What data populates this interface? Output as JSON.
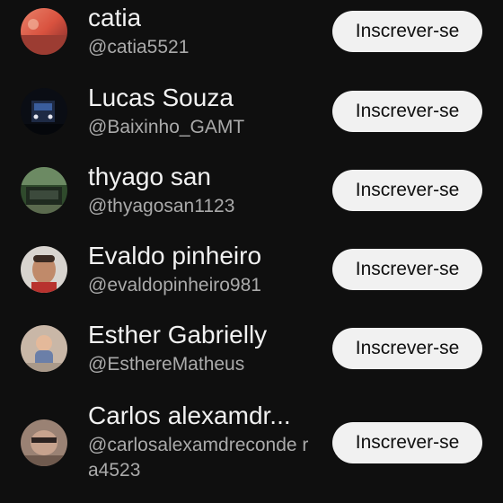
{
  "subscribe_label": "Inscrever-se",
  "channels": [
    {
      "name": "catia",
      "handle": "@catia5521"
    },
    {
      "name": "Lucas Souza",
      "handle": "@Baixinho_GAMT"
    },
    {
      "name": "thyago san",
      "handle": "@thyagosan1123"
    },
    {
      "name": "Evaldo pinheiro",
      "handle": "@evaldopinheiro981"
    },
    {
      "name": "Esther Gabrielly",
      "handle": "@EsthereMatheus"
    },
    {
      "name": "Carlos alexamdr...",
      "handle": "@carlosalexamdreconde ra4523"
    }
  ]
}
